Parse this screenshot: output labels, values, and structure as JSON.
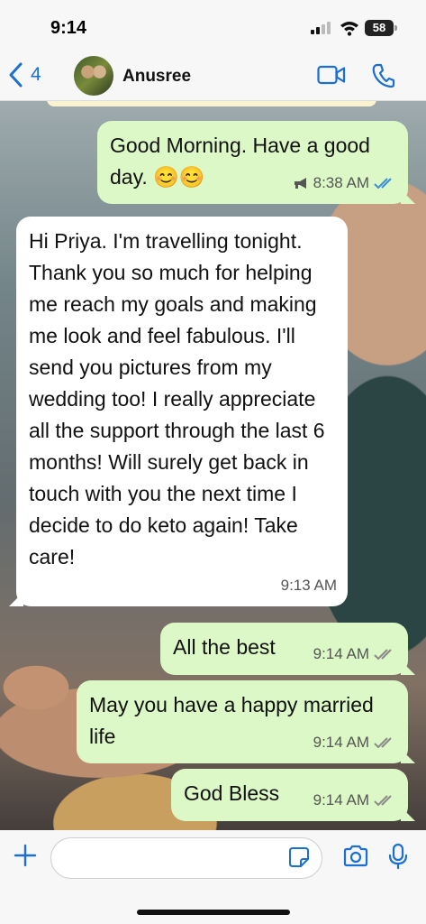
{
  "status_bar": {
    "time": "9:14",
    "battery": "58"
  },
  "header": {
    "back_count": "4",
    "contact_name": "Anusree"
  },
  "messages": [
    {
      "direction": "out",
      "text": "Good Morning. Have a good day. 😊😊",
      "time": "8:38 AM",
      "status": "read"
    },
    {
      "direction": "in",
      "text": "Hi Priya. I'm travelling tonight. Thank you so much for helping me reach my goals and making me look and feel fabulous. I'll send you pictures from my wedding too! I really appreciate all the support through the last 6 months! Will surely get back in touch with you the next time I decide to do keto again! Take care!",
      "time": "9:13 AM"
    },
    {
      "direction": "out",
      "text": "All the best",
      "time": "9:14 AM",
      "status": "delivered"
    },
    {
      "direction": "out",
      "text": "May you have a happy married life",
      "time": "9:14 AM",
      "status": "delivered"
    },
    {
      "direction": "out",
      "text": "God Bless",
      "time": "9:14 AM",
      "status": "delivered"
    }
  ],
  "composer": {
    "placeholder": ""
  },
  "colors": {
    "accent": "#1b6fd1",
    "outgoing_bubble": "#dcf8c6",
    "incoming_bubble": "#ffffff",
    "read_tick": "#3b8ed8",
    "delivered_tick": "#8a8a8a"
  }
}
